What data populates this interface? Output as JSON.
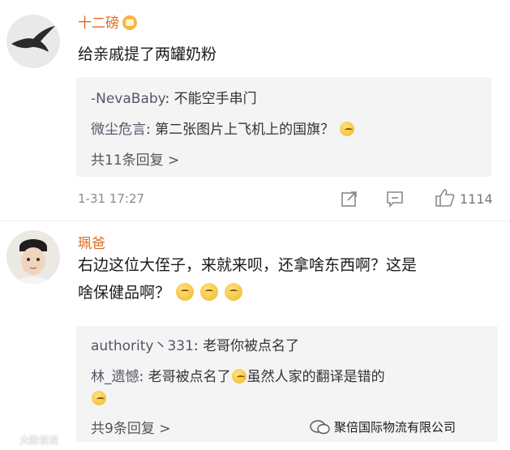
{
  "comments": [
    {
      "username": "十二磅",
      "text": "给亲戚提了两罐奶粉",
      "replies": [
        {
          "name": "-NevaBaby",
          "text": "不能空手串门"
        },
        {
          "name": "微尘危言",
          "text": "第二张图片上飞机上的国旗？"
        }
      ],
      "more": "共11条回复 >",
      "date": "1-31 17:27",
      "likes": "1114"
    },
    {
      "username": "珮爸",
      "text_line1": "右边这位大侄子，来就来呗，还拿啥东西啊？这是",
      "text_line2": "啥保健品啊？",
      "replies": [
        {
          "name": "authority丶331",
          "text": "老哥你被点名了"
        },
        {
          "name": "林_遗憾",
          "text_a": "老哥被点名了",
          "text_b": "虽然人家的翻译是错的"
        }
      ],
      "more": "共9条回复 >"
    }
  ],
  "watermark_left": "大脸说说",
  "watermark_right": "聚倍国际物流有限公司",
  "colors": {
    "username": "#e06a1a",
    "reply_bg": "#f4f4f4",
    "meta": "#8a8a8a"
  }
}
